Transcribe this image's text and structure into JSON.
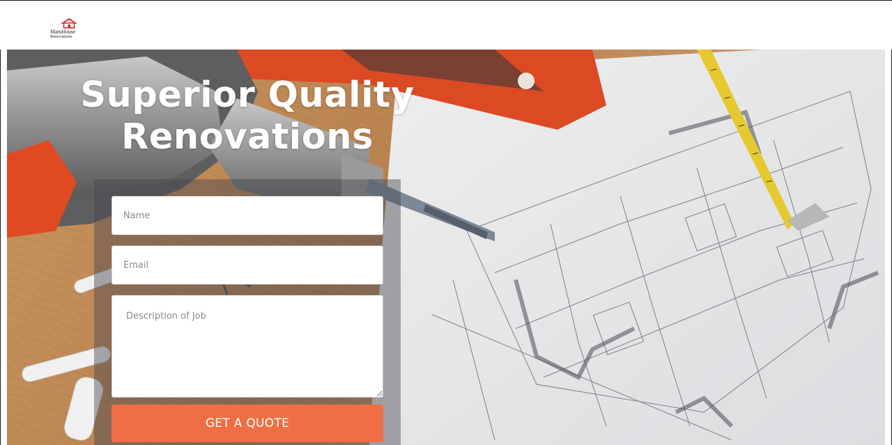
{
  "header": {
    "logo": {
      "line1": "MaruHouse",
      "line2": "Renovations",
      "icon": "house-roof-icon",
      "color": "#d42a2a"
    }
  },
  "hero": {
    "title_line1": "Superior Quality",
    "title_line2": "Renovations",
    "background": "drill-tape-measure-blueprint-photo"
  },
  "form": {
    "name_placeholder": "Name",
    "email_placeholder": "Email",
    "description_placeholder": "Description of Job",
    "submit_label": "GET A QUOTE",
    "accent_color": "#ef6f44"
  }
}
